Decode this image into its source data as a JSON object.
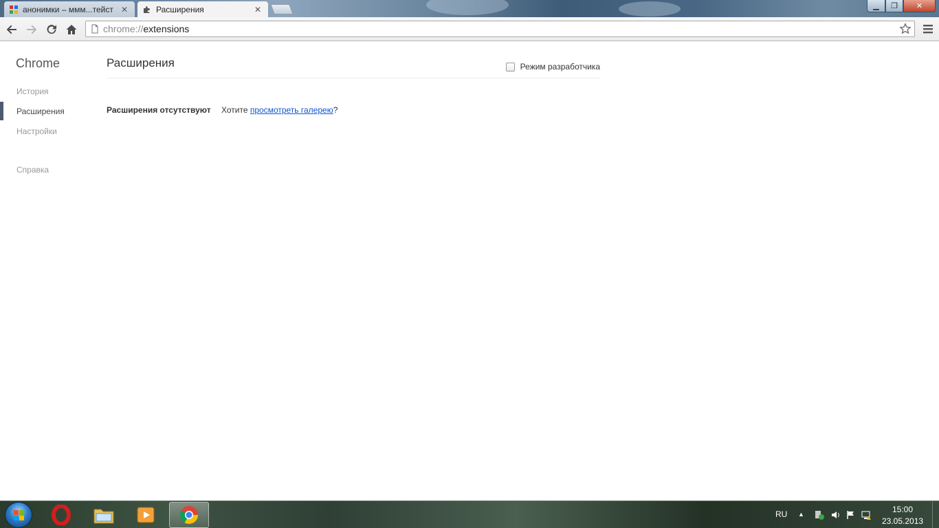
{
  "tabs": [
    {
      "title": "анонимки – ммм...тейст",
      "close": "✕",
      "active": false
    },
    {
      "title": "Расширения",
      "close": "✕",
      "active": true
    }
  ],
  "window_controls": {
    "minimize": "▁",
    "maximize": "❐",
    "close": "✕"
  },
  "address": {
    "scheme": "chrome://",
    "host": "extensions"
  },
  "sidebar": {
    "brand": "Chrome",
    "items": [
      {
        "label": "История",
        "selected": false
      },
      {
        "label": "Расширения",
        "selected": true
      },
      {
        "label": "Настройки",
        "selected": false
      },
      {
        "label": "Справка",
        "selected": false
      }
    ]
  },
  "main": {
    "title": "Расширения",
    "developer_mode": {
      "label": "Режим разработчика",
      "checked": false
    },
    "empty": {
      "strong": "Расширения отсутствуют",
      "prefix": "Хотите ",
      "link": "просмотреть галерею",
      "suffix": "?"
    }
  },
  "taskbar": {
    "apps": [
      "opera-icon",
      "file-explorer-icon",
      "media-player-icon",
      "chrome-icon"
    ],
    "lang": "RU",
    "tray_arrow": "▲",
    "time": "15:00",
    "date": "23.05.2013"
  },
  "colors": {
    "link": "#1155cc",
    "sidebar_selected_bar": "#4e5a70"
  }
}
